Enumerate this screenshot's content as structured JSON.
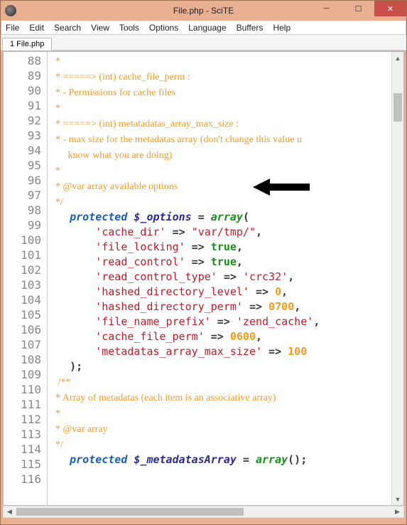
{
  "window": {
    "title": "File.php - SciTE"
  },
  "menu": {
    "file": "File",
    "edit": "Edit",
    "search": "Search",
    "view": "View",
    "tools": "Tools",
    "options": "Options",
    "language": "Language",
    "buffers": "Buffers",
    "help": "Help"
  },
  "tabs": {
    "t0": "1 File.php"
  },
  "lines": {
    "start": 88,
    "end": 116
  },
  "code": {
    "c88": "  *",
    "c89": "  * =====> (int) cache_file_perm :",
    "c90": "  * - Permissions for cache files",
    "c91": "  *",
    "c92": "  * =====> (int) metatadatas_array_max_size :",
    "c93": "  * - max size for the metadatas array (don't change this value u",
    "c93b": "       know what you are doing)",
    "c94": "  *",
    "c95": "  *",
    "c96": "  * @var array available options",
    "c97": "  */",
    "c98_kw": "protected",
    "c98_var": "$_options",
    "c98_eq": " = ",
    "c98_fn": "array",
    "c98_p": "(",
    "c99_k": "'cache_dir'",
    "c99_a": " => ",
    "c99_v": "\"var/tmp/\"",
    "c100_k": "'file_locking'",
    "c100_v": "true",
    "c101_k": "'read_control'",
    "c101_v": "true",
    "c102_k": "'read_control_type'",
    "c102_v": "'crc32'",
    "c103_k": "'hashed_directory_level'",
    "c103_v": "0",
    "c104_k": "'hashed_directory_perm'",
    "c104_v": "0700",
    "c105_k": "'file_name_prefix'",
    "c105_v": "'zend_cache'",
    "c106_k": "'cache_file_perm'",
    "c106_v": "0600",
    "c107_k": "'metadatas_array_max_size'",
    "c107_v": "100",
    "c108": "   );",
    "c110": "   /**",
    "c111": "  * Array of metadatas (each item is an associative array)",
    "c112": "  *",
    "c113": "  * @var array",
    "c114": "  */",
    "c115_kw": "protected",
    "c115_var": "$_metadatasArray",
    "c115_fn": "array",
    "c115_end": "();"
  }
}
